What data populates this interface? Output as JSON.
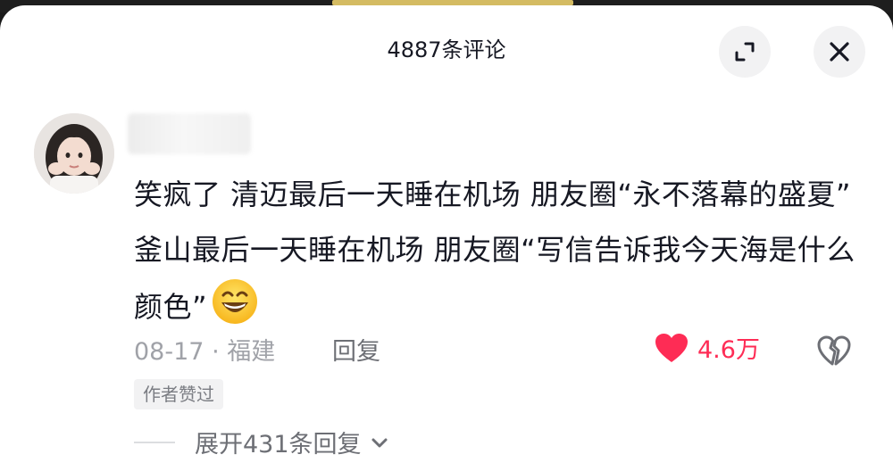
{
  "header": {
    "title": "4887条评论"
  },
  "icons": {
    "expand": "expand-icon",
    "close": "close-icon",
    "heart": "heart-icon",
    "dislike": "broken-heart-icon",
    "emoji": "grinning-face-emoji",
    "chevron": "chevron-down-icon"
  },
  "comment": {
    "text": "笑疯了 清迈最后一天睡在机场 朋友圈“永不落幕的盛夏” 釜山最后一天睡在机场 朋友圈“写信告诉我今天海是什么颜色”",
    "date": "08-17",
    "separator": "·",
    "location": "福建",
    "reply_label": "回复",
    "like_count": "4.6万",
    "author_badge": "作者赞过",
    "expand_replies": "展开431条回复"
  },
  "colors": {
    "accent": "#fe2c55",
    "text": "#161823",
    "muted": "#a0a2a8"
  }
}
